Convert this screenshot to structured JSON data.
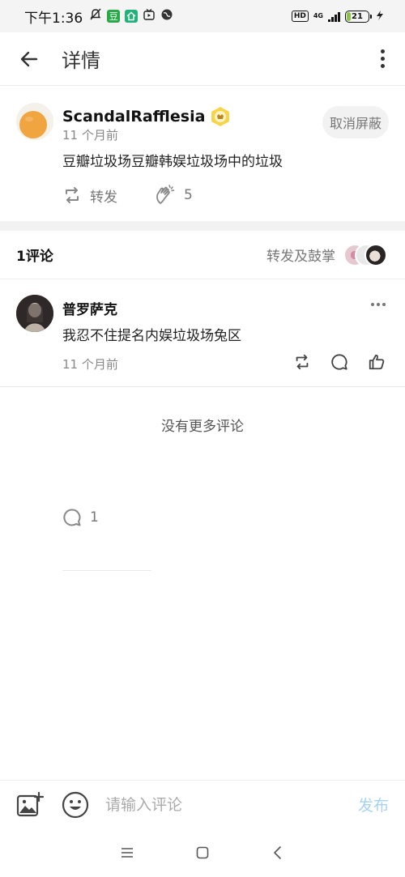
{
  "status_bar": {
    "time": "下午1:36",
    "douban_icon_text": "豆",
    "network": "4G",
    "hd": "HD",
    "battery": "21",
    "battery_level": 0.21
  },
  "header": {
    "title": "详情"
  },
  "post": {
    "author": "ScandalRafflesia",
    "time": "11 个月前",
    "unblock_label": "取消屏蔽",
    "text": "豆瓣垃圾场豆瓣韩娱垃圾场中的垃圾",
    "repost_label": "转发",
    "comment_count": "1",
    "applause_count": "5"
  },
  "comments_header": {
    "count_label": "1评论",
    "repost_applause_label": "转发及鼓掌"
  },
  "comments": [
    {
      "author": "普罗萨克",
      "text": "我忍不住提名内娱垃圾场兔区",
      "time": "11 个月前"
    }
  ],
  "no_more_text": "没有更多评论",
  "input_bar": {
    "placeholder": "请输入评论",
    "publish_label": "发布"
  },
  "colors": {
    "accent_disabled": "#a8d3f0",
    "douban_green": "#2aa84a",
    "muted_text": "#888888"
  }
}
